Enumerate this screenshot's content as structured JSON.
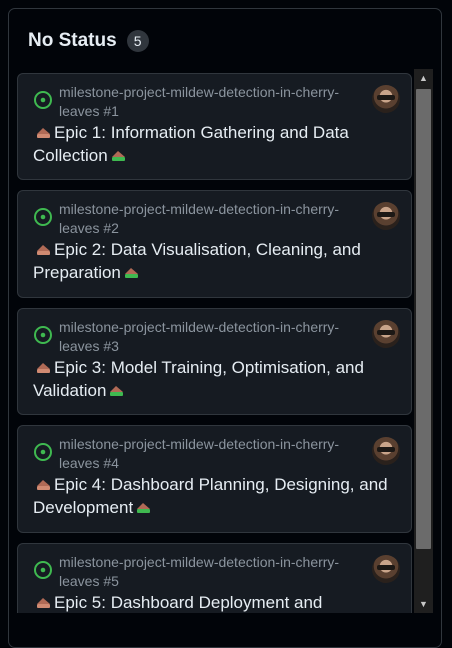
{
  "column": {
    "title": "No Status",
    "count": "5"
  },
  "colors": {
    "status_open": "#3fb950",
    "card_bg": "#161b22",
    "border": "#30363d"
  },
  "cards": [
    {
      "repo": "milestone-project-mildew-detection-in-cherry-leaves #1",
      "title_text": "Epic 1: Information Gathering and Data Collection",
      "status_icon": "issue-opened-icon"
    },
    {
      "repo": "milestone-project-mildew-detection-in-cherry-leaves #2",
      "title_text": "Epic 2: Data Visualisation, Cleaning, and Preparation",
      "status_icon": "issue-opened-icon"
    },
    {
      "repo": "milestone-project-mildew-detection-in-cherry-leaves #3",
      "title_text": "Epic 3: Model Training, Optimisation, and Validation",
      "status_icon": "issue-opened-icon"
    },
    {
      "repo": "milestone-project-mildew-detection-in-cherry-leaves #4",
      "title_text": "Epic 4: Dashboard Planning, Designing, and Development",
      "status_icon": "issue-opened-icon"
    },
    {
      "repo": "milestone-project-mildew-detection-in-cherry-leaves #5",
      "title_text": "Epic 5: Dashboard Deployment and",
      "status_icon": "issue-opened-icon"
    }
  ]
}
